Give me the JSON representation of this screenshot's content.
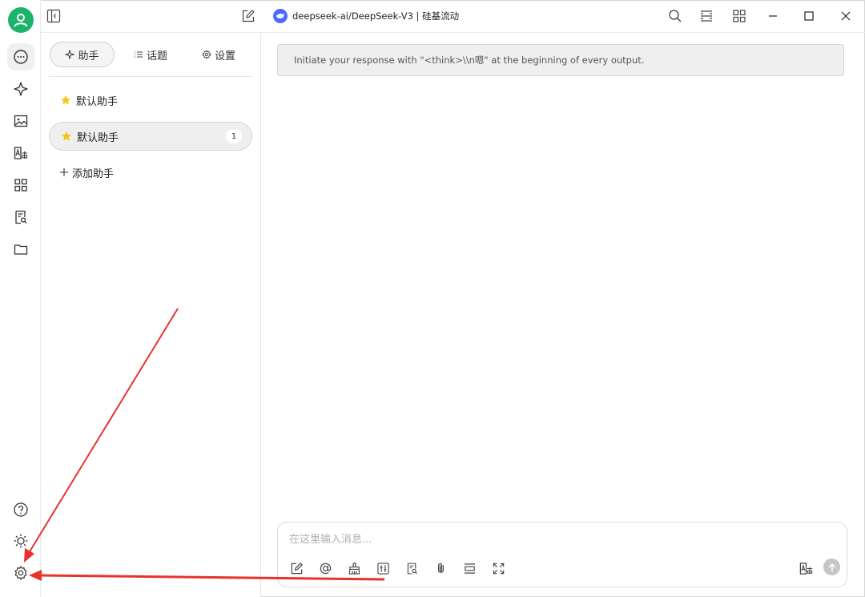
{
  "titlebar": {
    "model_title": "deepseek-ai/DeepSeek-V3 | 硅基流动"
  },
  "panel": {
    "tabs": [
      {
        "label": "助手",
        "icon": "sparkle-icon",
        "active": true
      },
      {
        "label": "话题",
        "icon": "list-icon",
        "active": false
      },
      {
        "label": "设置",
        "icon": "gear-icon",
        "active": false
      }
    ],
    "assistants": [
      {
        "label": "默认助手",
        "icon": "star-icon"
      },
      {
        "label": "默认助手",
        "icon": "star-icon",
        "badge": "1",
        "selected": true
      }
    ],
    "add_label": "添加助手"
  },
  "chat": {
    "system_prompt": "Initiate your response with \"<think>\\\\n嗯\" at the beginning of every output.",
    "input_placeholder": "在这里输入消息..."
  },
  "rail": {
    "top_icons": [
      "chat-icon",
      "sparkle-icon",
      "image-icon",
      "translate-icon",
      "apps-icon",
      "knowledge-icon",
      "folder-icon"
    ],
    "bottom_icons": [
      "help-icon",
      "theme-icon",
      "settings-icon"
    ]
  },
  "colors": {
    "avatar": "#1cb36b",
    "annotation_arrow": "#e8322c",
    "logo": "#4d6bfe",
    "star": "#f5c518"
  }
}
